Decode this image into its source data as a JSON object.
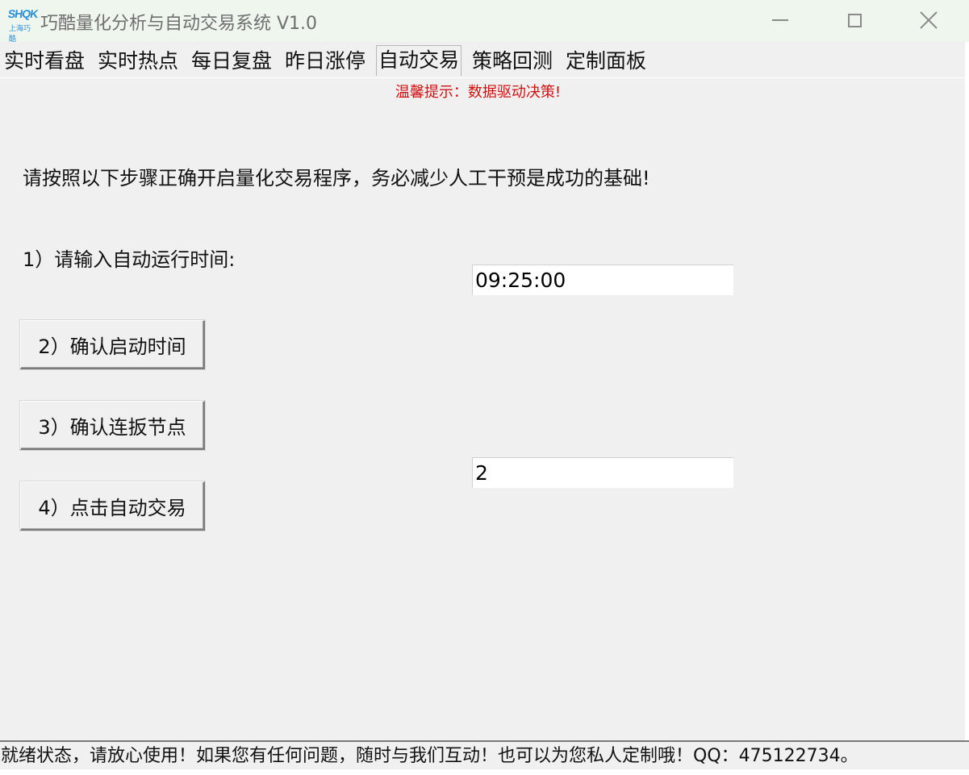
{
  "window": {
    "logo_top": "SHQK",
    "logo_bottom": "上海巧酷",
    "title": "巧酷量化分析与自动交易系统 V1.0"
  },
  "tabs": [
    {
      "label": "实时看盘",
      "active": false
    },
    {
      "label": "实时热点",
      "active": false
    },
    {
      "label": "每日复盘",
      "active": false
    },
    {
      "label": "昨日涨停",
      "active": false
    },
    {
      "label": "自动交易",
      "active": true
    },
    {
      "label": "策略回测",
      "active": false
    },
    {
      "label": "定制面板",
      "active": false
    }
  ],
  "tip": "温馨提示：数据驱动决策!",
  "main": {
    "instruction": "请按照以下步骤正确开启量化交易程序，务必减少人工干预是成功的基础!",
    "step1_label": "1）请输入自动运行时间:",
    "time_value": "09:25:00",
    "step2_button": "2）确认启动时间",
    "step3_button": "3）确认连扳节点",
    "node_value": "2",
    "step4_button": "4）点击自动交易"
  },
  "statusbar": {
    "text": "就绪状态，请放心使用！如果您有任何问题，随时与我们互动！也可以为您私人定制哦！QQ：475122734。"
  },
  "colors": {
    "tip": "#d01010",
    "logo": "#2a8fd6",
    "titlebar": "#eef6ee"
  }
}
